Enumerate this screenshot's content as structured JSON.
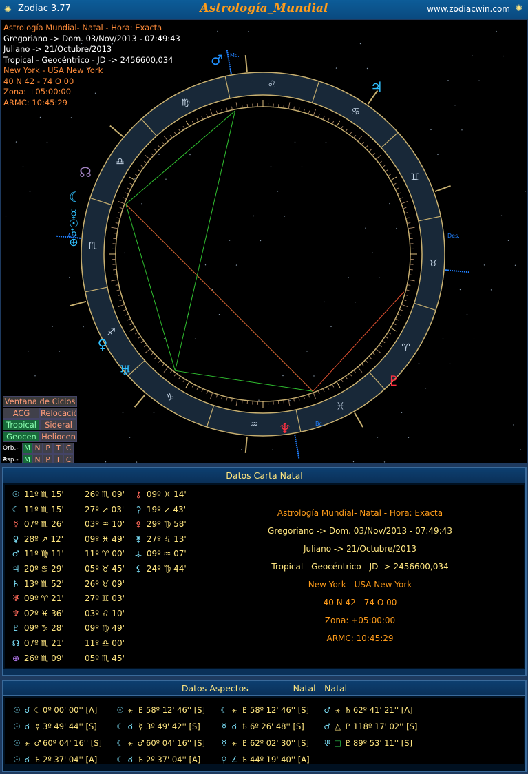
{
  "titlebar": {
    "app_title": "Zodiac 3.77",
    "chart_title": "Astrología_Mundial",
    "website": "www.zodiacwin.com",
    "app_icon": "zodiac-app-icon",
    "close_icon": "close-icon"
  },
  "chart_header": [
    {
      "text": "Astrología Mundial- Natal - Hora: Exacta",
      "color": "orange"
    },
    {
      "text": "Gregoriano -> Dom. 03/Nov/2013 - 07:49:43",
      "color": "white"
    },
    {
      "text": "Juliano -> 21/Octubre/2013",
      "color": "white"
    },
    {
      "text": "Tropical - Geocéntrico - JD -> 2456600,034",
      "color": "white"
    },
    {
      "text": "New York - USA New York",
      "color": "orange"
    },
    {
      "text": "40 N 42 - 74 O 00",
      "color": "orange"
    },
    {
      "text": "Zona: +05:00:00",
      "color": "orange"
    },
    {
      "text": "ARMC: 10:45:29",
      "color": "orange"
    }
  ],
  "wheel": {
    "mc_label": "Mc.",
    "asc_label": "Asc.",
    "des_label": "Des.",
    "bc_label": "Bc.",
    "sign_glyphs": [
      "♈",
      "♉",
      "♊",
      "♋",
      "♌",
      "♍",
      "♎",
      "♏",
      "♐",
      "♑",
      "♒",
      "♓"
    ],
    "planet_glyphs": {
      "mars": "♂",
      "jupiter": "♃",
      "venus": "♀",
      "uranus": "♅",
      "pluto": "♇",
      "neptune": "♆",
      "node": "☊",
      "moon": "☾",
      "mercury": "☿",
      "saturn": "♄",
      "sun": "☉",
      "fortuna": "⊕"
    }
  },
  "side_buttons": {
    "ventana": "Ventana de Ciclos",
    "acg": "ACG",
    "relocacion": "Relocación",
    "tropical": "Tropical",
    "sideral": "Sideral",
    "geocen": "Geocen",
    "heliocen": "Heliocen",
    "orb_label": "Orb.->",
    "asp_label": "Asp.->",
    "letters": [
      "M",
      "N",
      "P",
      "T",
      "C"
    ]
  },
  "natal_panel": {
    "title": "Datos Carta Natal",
    "col1": [
      {
        "g": "☉",
        "gc": "#7fe6ff",
        "t": "11º ♏ 15'"
      },
      {
        "g": "☾",
        "gc": "#7fe6ff",
        "t": "11º ♏ 15'"
      },
      {
        "g": "☿",
        "gc": "#ff6a5a",
        "t": "07º ♏ 26'"
      },
      {
        "g": "♀",
        "gc": "#7fe6ff",
        "t": "28º ↗ 12'"
      },
      {
        "g": "♂",
        "gc": "#7fe6ff",
        "t": "11º ♍ 11'"
      },
      {
        "g": "♃",
        "gc": "#7fe6ff",
        "t": "20º ♋ 29'"
      },
      {
        "g": "♄",
        "gc": "#7fe6ff",
        "t": "13º ♏ 52'"
      },
      {
        "g": "♅",
        "gc": "#ff6a5a",
        "t": "09º ♈ 21'"
      },
      {
        "g": "♆",
        "gc": "#ff6a5a",
        "t": "02º ♓ 36'"
      },
      {
        "g": "♇",
        "gc": "#7fe6ff",
        "t": "09º ♑ 28'"
      },
      {
        "g": "☊",
        "gc": "#7fe6ff",
        "t": "07º ♏ 21'"
      },
      {
        "g": "⊕",
        "gc": "#c080ff",
        "t": "26º ♏ 09'"
      }
    ],
    "col2": [
      "26º ♏ 09'",
      "27º ↗ 03'",
      "03º ♒ 10'",
      "09º ♓ 49'",
      "11º ♈ 00'",
      "05º ♉ 45'",
      "26º ♉ 09'",
      "27º ♊ 03'",
      "03º ♌ 10'",
      "09º ♍ 49'",
      "11º ♎ 00'",
      "05º ♏ 45'"
    ],
    "col3": [
      {
        "g": "⚷",
        "gc": "#ff6a5a",
        "t": "09º ♓ 14'"
      },
      {
        "g": "⚳",
        "gc": "#7fe6ff",
        "t": "19º ↗ 43'"
      },
      {
        "g": "⚴",
        "gc": "#ff6a5a",
        "t": "29º ♍ 58'"
      },
      {
        "g": "⚵",
        "gc": "#7fe6ff",
        "t": "27º ♌ 13'"
      },
      {
        "g": "⚶",
        "gc": "#7fe6ff",
        "t": "09º ♒ 07'"
      },
      {
        "g": "⚸",
        "gc": "#7fe6ff",
        "t": "24º ♍ 44'"
      }
    ],
    "info": [
      {
        "text": "Astrología Mundial- Natal - Hora: Exacta",
        "color": "#ff9c1a"
      },
      {
        "text": "Gregoriano -> Dom. 03/Nov/2013 - 07:49:43",
        "color": "#ffe680"
      },
      {
        "text": "Juliano -> 21/Octubre/2013",
        "color": "#ffe680"
      },
      {
        "text": "Tropical - Geocéntrico - JD -> 2456600,034",
        "color": "#ffe680"
      },
      {
        "text": "New York - USA New York",
        "color": "#ff9c1a"
      },
      {
        "text": "40 N 42 - 74 O 00",
        "color": "#ff9c1a"
      },
      {
        "text": "Zona: +05:00:00",
        "color": "#ff9c1a"
      },
      {
        "text": "ARMC: 10:45:29",
        "color": "#ff9c1a"
      }
    ]
  },
  "aspects_panel": {
    "title_left": "Datos Aspectos",
    "title_sep": "——",
    "title_right": "Natal - Natal",
    "columns": [
      [
        {
          "p1": "☉",
          "a": "☌",
          "ac": "#7fe6ff",
          "p2": "☾",
          "t": "0º 00' 00'' [A]"
        },
        {
          "p1": "☉",
          "a": "☌",
          "ac": "#7fe6ff",
          "p2": "☿",
          "t": "3º 49' 44'' [S]"
        },
        {
          "p1": "☉",
          "a": "⚹",
          "ac": "#ffe680",
          "p2": "♂",
          "t": "60º 04' 16'' [S]"
        },
        {
          "p1": "☉",
          "a": "☌",
          "ac": "#7fe6ff",
          "p2": "♄",
          "t": "2º 37' 04'' [A]"
        }
      ],
      [
        {
          "p1": "☉",
          "a": "⚹",
          "ac": "#ffe680",
          "p2": "♇",
          "t": "58º 12' 46'' [S]"
        },
        {
          "p1": "☾",
          "a": "☌",
          "ac": "#7fe6ff",
          "p2": "☿",
          "t": "3º 49' 42'' [S]"
        },
        {
          "p1": "☾",
          "a": "⚹",
          "ac": "#ffe680",
          "p2": "♂",
          "t": "60º 04' 16'' [S]"
        },
        {
          "p1": "☾",
          "a": "☌",
          "ac": "#7fe6ff",
          "p2": "♄",
          "t": "2º 37' 04'' [A]"
        }
      ],
      [
        {
          "p1": "☾",
          "a": "⚹",
          "ac": "#ffe680",
          "p2": "♇",
          "t": "58º 12' 46'' [S]"
        },
        {
          "p1": "☿",
          "a": "☌",
          "ac": "#7fe6ff",
          "p2": "♄",
          "t": "6º 26' 48'' [S]"
        },
        {
          "p1": "☿",
          "a": "⚹",
          "ac": "#ffe680",
          "p2": "♇",
          "t": "62º 02' 30'' [S]"
        },
        {
          "p1": "♀",
          "a": "∠",
          "ac": "#7fe6ff",
          "p2": "♄",
          "t": "44º 19' 40'' [A]"
        }
      ],
      [
        {
          "p1": "♂",
          "a": "⚹",
          "ac": "#ffe680",
          "p2": "♄",
          "t": "62º 41' 21'' [A]"
        },
        {
          "p1": "♂",
          "a": "△",
          "ac": "#ffe680",
          "p2": "♇",
          "t": "118º 17' 02'' [S]"
        },
        {
          "p1": "♅",
          "a": "□",
          "ac": "#30d050",
          "p2": "♇",
          "t": "89º 53' 11'' [S]"
        }
      ]
    ]
  }
}
